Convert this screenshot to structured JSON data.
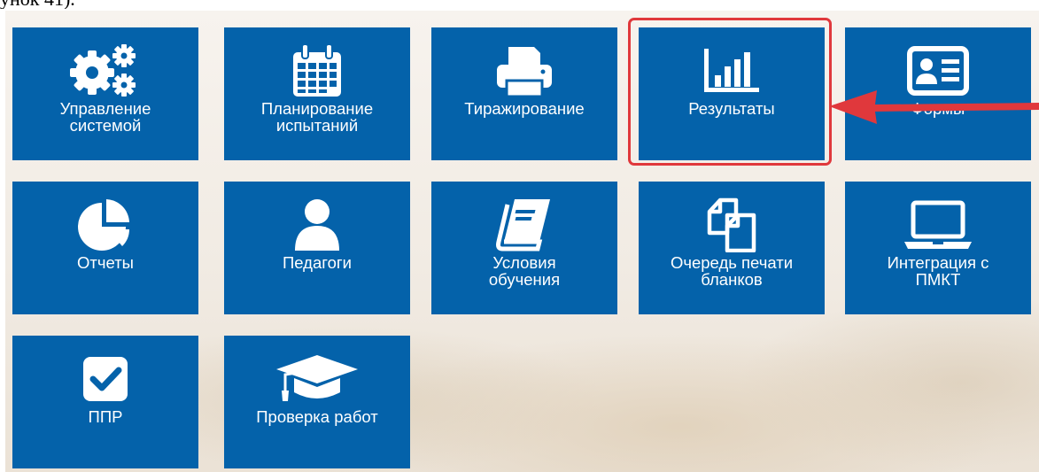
{
  "caption": "унок 41).",
  "tiles": [
    {
      "label": "Управление\nсистемой",
      "icon": "gears-icon"
    },
    {
      "label": "Планирование\nиспытаний",
      "icon": "calendar-icon"
    },
    {
      "label": "Тиражирование",
      "icon": "printer-icon"
    },
    {
      "label": "Результаты",
      "icon": "bar-chart-icon"
    },
    {
      "label": "Формы",
      "icon": "id-card-icon"
    },
    {
      "label": "Отчеты",
      "icon": "pie-chart-icon"
    },
    {
      "label": "Педагоги",
      "icon": "user-icon"
    },
    {
      "label": "Условия\nобучения",
      "icon": "book-icon"
    },
    {
      "label": "Очередь печати\nбланков",
      "icon": "copy-icon"
    },
    {
      "label": "Интеграция с\nПМКТ",
      "icon": "laptop-icon"
    },
    {
      "label": "ППР",
      "icon": "checkbox-icon"
    },
    {
      "label": "Проверка работ",
      "icon": "graduation-cap-icon"
    }
  ],
  "highlight_color": "#e0383c",
  "tile_color": "#0462aa"
}
